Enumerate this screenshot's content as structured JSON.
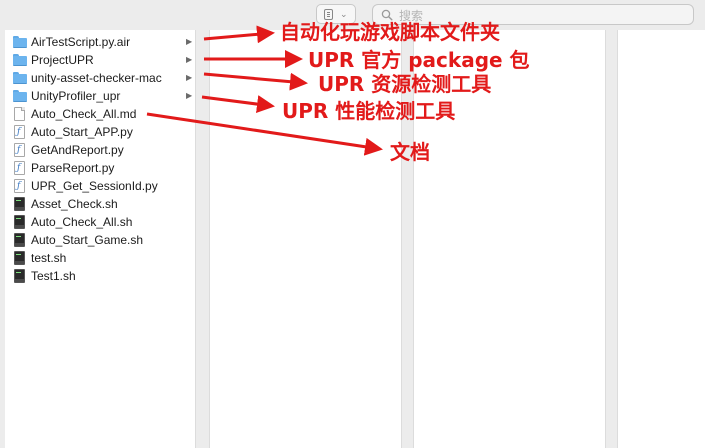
{
  "toolbar": {
    "search_placeholder": "搜索"
  },
  "files": [
    {
      "name": "AirTestScript.py.air",
      "kind": "folder",
      "icon": "folder-icon",
      "has_children": true
    },
    {
      "name": "ProjectUPR",
      "kind": "folder",
      "icon": "folder-icon",
      "has_children": true
    },
    {
      "name": "unity-asset-checker-mac",
      "kind": "folder",
      "icon": "folder-icon",
      "has_children": true
    },
    {
      "name": "UnityProfiler_upr",
      "kind": "folder",
      "icon": "folder-icon",
      "has_children": true
    },
    {
      "name": "Auto_Check_All.md",
      "kind": "doc",
      "icon": "document-icon",
      "has_children": false
    },
    {
      "name": "Auto_Start_APP.py",
      "kind": "py",
      "icon": "python-file-icon",
      "has_children": false
    },
    {
      "name": "GetAndReport.py",
      "kind": "py",
      "icon": "python-file-icon",
      "has_children": false
    },
    {
      "name": "ParseReport.py",
      "kind": "py",
      "icon": "python-file-icon",
      "has_children": false
    },
    {
      "name": "UPR_Get_SessionId.py",
      "kind": "py",
      "icon": "python-file-icon",
      "has_children": false
    },
    {
      "name": "Asset_Check.sh",
      "kind": "sh",
      "icon": "shell-script-icon",
      "has_children": false
    },
    {
      "name": "Auto_Check_All.sh",
      "kind": "sh",
      "icon": "shell-script-icon",
      "has_children": false
    },
    {
      "name": "Auto_Start_Game.sh",
      "kind": "sh",
      "icon": "shell-script-icon",
      "has_children": false
    },
    {
      "name": "test.sh",
      "kind": "sh",
      "icon": "shell-script-icon",
      "has_children": false
    },
    {
      "name": "Test1.sh",
      "kind": "sh",
      "icon": "shell-script-icon",
      "has_children": false
    }
  ],
  "annotations": {
    "airtest": "自动化玩游戏脚本文件夹",
    "project_upr": "UPR 官方 package 包",
    "asset_checker": "UPR 资源检测工具",
    "profiler": "UPR 性能检测工具",
    "doc": "文档"
  },
  "colors": {
    "annotation": "#e21a1a",
    "folder": "#6cb4ee",
    "background": "#ececec"
  }
}
